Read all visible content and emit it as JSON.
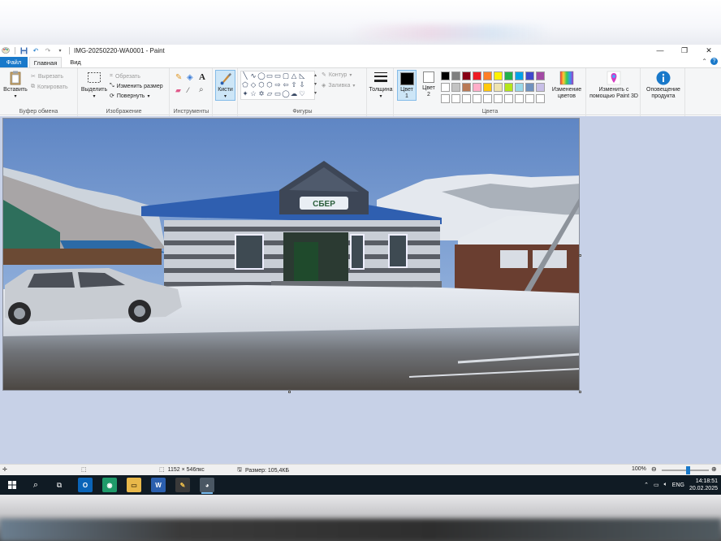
{
  "window": {
    "title": "IMG-20250220-WA0001 - Paint",
    "minimize_glyph": "—",
    "maximize_glyph": "❐",
    "close_glyph": "✕"
  },
  "tabs": {
    "file": "Файл",
    "home": "Главная",
    "view": "Вид"
  },
  "ribbon": {
    "clipboard": {
      "paste": "Вставить",
      "cut": "Вырезать",
      "copy": "Копировать",
      "label": "Буфер обмена"
    },
    "image": {
      "select": "Выделить",
      "crop": "Обрезать",
      "resize": "Изменить размер",
      "rotate": "Повернуть",
      "label": "Изображение"
    },
    "tools": {
      "label": "Инструменты"
    },
    "brushes": {
      "label": "Кисти"
    },
    "shapes": {
      "outline": "Контур",
      "fill": "Заливка",
      "label": "Фигуры",
      "items": [
        "╲",
        "∿",
        "◯",
        "▭",
        "▭",
        "▢",
        "△",
        "◺",
        "⬠",
        "◇",
        "⬡",
        "⬡",
        "⇨",
        "⇦",
        "⇧",
        "⇩",
        "✦",
        "☆",
        "✡",
        "▱",
        "▭",
        "◯",
        "☁",
        "♡"
      ]
    },
    "size": {
      "label": "Толщина"
    },
    "colors": {
      "color1_line1": "Цвет",
      "color1_line2": "1",
      "color2_line1": "Цвет",
      "color2_line2": "2",
      "edit_colors_line1": "Изменение",
      "edit_colors_line2": "цветов",
      "paint3d_line1": "Изменить с",
      "paint3d_line2": "помощью Paint 3D",
      "notify_line1": "Оповещение",
      "notify_line2": "продукта",
      "label": "Цвета",
      "palette": [
        "#000000",
        "#7f7f7f",
        "#880015",
        "#ed1c24",
        "#ff7f27",
        "#fff200",
        "#22b14c",
        "#00a2e8",
        "#3f48cc",
        "#a349a4",
        "#ffffff",
        "#c3c3c3",
        "#b97a57",
        "#ffaec9",
        "#ffc90e",
        "#efe4b0",
        "#b5e61d",
        "#99d9ea",
        "#7092be",
        "#c8bfe7",
        "#ffffff",
        "#ffffff",
        "#ffffff",
        "#ffffff",
        "#ffffff",
        "#ffffff",
        "#ffffff",
        "#ffffff",
        "#ffffff",
        "#ffffff"
      ]
    }
  },
  "status": {
    "dimensions": "1152 × 546пкс",
    "file_size": "Размер: 105,4КБ",
    "zoom": "100%",
    "zoom_level": 0.55
  },
  "photo": {
    "sign_text": "СБЕР"
  },
  "taskbar": {
    "language": "ENG",
    "time": "14:18:51",
    "date": "20.02.2025"
  }
}
